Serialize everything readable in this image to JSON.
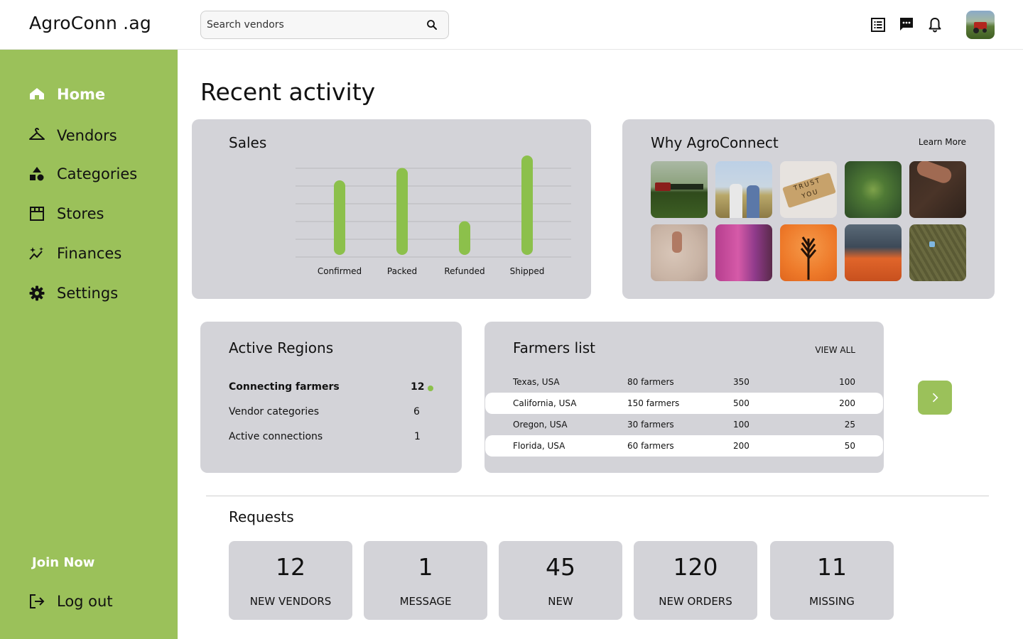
{
  "app": {
    "brand": "AgroConn .ag",
    "accent_color": "#9bc15a"
  },
  "search": {
    "placeholder": "Search vendors",
    "icon": "search-icon"
  },
  "topbar_icons": [
    "list-icon",
    "chat-icon",
    "bell-icon"
  ],
  "sidebar": {
    "items": [
      {
        "label": "Home",
        "icon": "home-icon",
        "active": true
      },
      {
        "label": "Vendors",
        "icon": "hanger-icon",
        "active": false
      },
      {
        "label": "Categories",
        "icon": "shapes-icon",
        "active": false
      },
      {
        "label": "Stores",
        "icon": "store-icon",
        "active": false
      },
      {
        "label": "Finances",
        "icon": "chart-sparkle-icon",
        "active": false
      },
      {
        "label": "Settings",
        "icon": "gear-icon",
        "active": false
      }
    ],
    "join_label": "Join Now",
    "logout_label": "Log out"
  },
  "page": {
    "title": "Recent activity"
  },
  "sales": {
    "title": "Sales",
    "chart_data": {
      "type": "bar",
      "categories": [
        "Confirmed",
        "Packed",
        "Refunded",
        "Shipped"
      ],
      "values": [
        4.2,
        4.9,
        1.9,
        5.6
      ],
      "ylim": [
        0,
        5
      ],
      "grid": true,
      "bar_color": "#8cc04b",
      "title": "Sales",
      "xlabel": "",
      "ylabel": ""
    }
  },
  "why": {
    "title": "Why AgroConnect",
    "learn_more": "Learn More",
    "images": [
      "tractor-field-photo",
      "two-farmers-photo",
      "trust-you-tiles-photo",
      "broccoli-aerial-photo",
      "hands-in-soil-photo",
      "seeds-map-photo",
      "people-embracing-photo",
      "wheat-silhouette-photo",
      "market-carrots-photo",
      "aerial-field-photo"
    ]
  },
  "regions": {
    "title": "Active Regions",
    "rows": [
      {
        "label": "Connecting farmers",
        "value": "12",
        "dot": true
      },
      {
        "label": "Vendor categories",
        "value": "6",
        "dot": false
      },
      {
        "label": "Active connections",
        "value": "1",
        "dot": false
      }
    ]
  },
  "farmers": {
    "title": "Farmers list",
    "view_all": "VIEW ALL",
    "rows": [
      {
        "region": "Texas, USA",
        "farmers": "80 farmers",
        "a": "350",
        "b": "100",
        "highlight": false
      },
      {
        "region": "California, USA",
        "farmers": "150 farmers",
        "a": "500",
        "b": "200",
        "highlight": true
      },
      {
        "region": "Oregon, USA",
        "farmers": "30 farmers",
        "a": "100",
        "b": "25",
        "highlight": false
      },
      {
        "region": "Florida, USA",
        "farmers": "60 farmers",
        "a": "200",
        "b": "50",
        "highlight": true
      }
    ]
  },
  "requests": {
    "title": "Requests",
    "cards": [
      {
        "value": "12",
        "label": "NEW VENDORS"
      },
      {
        "value": "1",
        "label": "MESSAGE"
      },
      {
        "value": "45",
        "label": "NEW"
      },
      {
        "value": "120",
        "label": "NEW ORDERS"
      },
      {
        "value": "11",
        "label": "MISSING"
      }
    ]
  }
}
